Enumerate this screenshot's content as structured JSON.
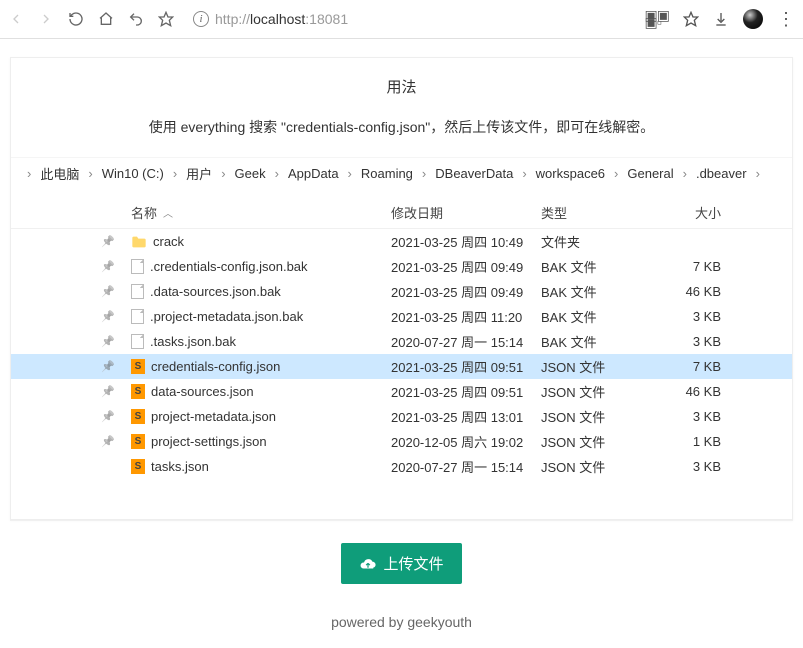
{
  "browser": {
    "url_prefix": "http://",
    "url_host": "localhost",
    "url_port": ":18081"
  },
  "page": {
    "title": "用法",
    "description": "使用 everything 搜索 \"credentials-config.json\"，然后上传该文件，即可在线解密。",
    "upload_label": "上传文件",
    "footer": "powered by geekyouth"
  },
  "breadcrumb": [
    "此电脑",
    "Win10 (C:)",
    "用户",
    "Geek",
    "AppData",
    "Roaming",
    "DBeaverData",
    "workspace6",
    "General",
    ".dbeaver"
  ],
  "columns": {
    "name": "名称",
    "modified": "修改日期",
    "type": "类型",
    "size": "大小"
  },
  "files": [
    {
      "icon": "folder",
      "pin": true,
      "name": "crack",
      "modified": "2021-03-25 周四 10:49",
      "type": "文件夹",
      "size": "",
      "selected": false
    },
    {
      "icon": "blank",
      "pin": true,
      "name": ".credentials-config.json.bak",
      "modified": "2021-03-25 周四 09:49",
      "type": "BAK 文件",
      "size": "7 KB",
      "selected": false
    },
    {
      "icon": "blank",
      "pin": true,
      "name": ".data-sources.json.bak",
      "modified": "2021-03-25 周四 09:49",
      "type": "BAK 文件",
      "size": "46 KB",
      "selected": false
    },
    {
      "icon": "blank",
      "pin": true,
      "name": ".project-metadata.json.bak",
      "modified": "2021-03-25 周四 11:20",
      "type": "BAK 文件",
      "size": "3 KB",
      "selected": false
    },
    {
      "icon": "blank",
      "pin": true,
      "name": ".tasks.json.bak",
      "modified": "2020-07-27 周一 15:14",
      "type": "BAK 文件",
      "size": "3 KB",
      "selected": false
    },
    {
      "icon": "sublime",
      "pin": true,
      "name": "credentials-config.json",
      "modified": "2021-03-25 周四 09:51",
      "type": "JSON 文件",
      "size": "7 KB",
      "selected": true
    },
    {
      "icon": "sublime",
      "pin": true,
      "name": "data-sources.json",
      "modified": "2021-03-25 周四 09:51",
      "type": "JSON 文件",
      "size": "46 KB",
      "selected": false
    },
    {
      "icon": "sublime",
      "pin": true,
      "name": "project-metadata.json",
      "modified": "2021-03-25 周四 13:01",
      "type": "JSON 文件",
      "size": "3 KB",
      "selected": false
    },
    {
      "icon": "sublime",
      "pin": true,
      "name": "project-settings.json",
      "modified": "2020-12-05 周六 19:02",
      "type": "JSON 文件",
      "size": "1 KB",
      "selected": false
    },
    {
      "icon": "sublime",
      "pin": false,
      "name": "tasks.json",
      "modified": "2020-07-27 周一 15:14",
      "type": "JSON 文件",
      "size": "3 KB",
      "selected": false
    }
  ]
}
